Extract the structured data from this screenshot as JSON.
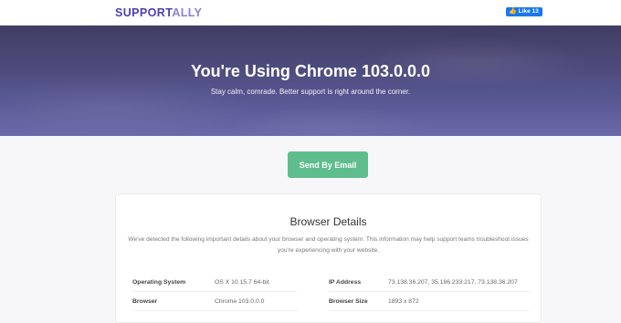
{
  "header": {
    "logo_part1": "SUPPORT",
    "logo_part2": "ALLY",
    "like_label": "Like 13"
  },
  "hero": {
    "title": "You're Using Chrome 103.0.0.0",
    "subtitle": "Stay calm, comrade. Better support is right around the corner."
  },
  "actions": {
    "send_email_label": "Send By Email"
  },
  "details": {
    "title": "Browser Details",
    "description": "We've detected the following important details about your browser and operating system. This information may help support teams troubleshoot issues you're experiencing with your website.",
    "rows": [
      {
        "label": "Operating System",
        "value": "OS X 10.15.7 64-bit"
      },
      {
        "label": "Browser",
        "value": "Chrome 103.0.0.0"
      },
      {
        "label": "IP Address",
        "value": "73.138.36.207, 35.186.233.217, 73.138.36.207"
      },
      {
        "label": "Browser Size",
        "value": "1893 x 872"
      }
    ]
  },
  "colors": {
    "brand": "#4a3fb8",
    "brand_light": "#8b80d6",
    "cta_green": "#5ebd8c",
    "facebook_blue": "#1877f2"
  }
}
